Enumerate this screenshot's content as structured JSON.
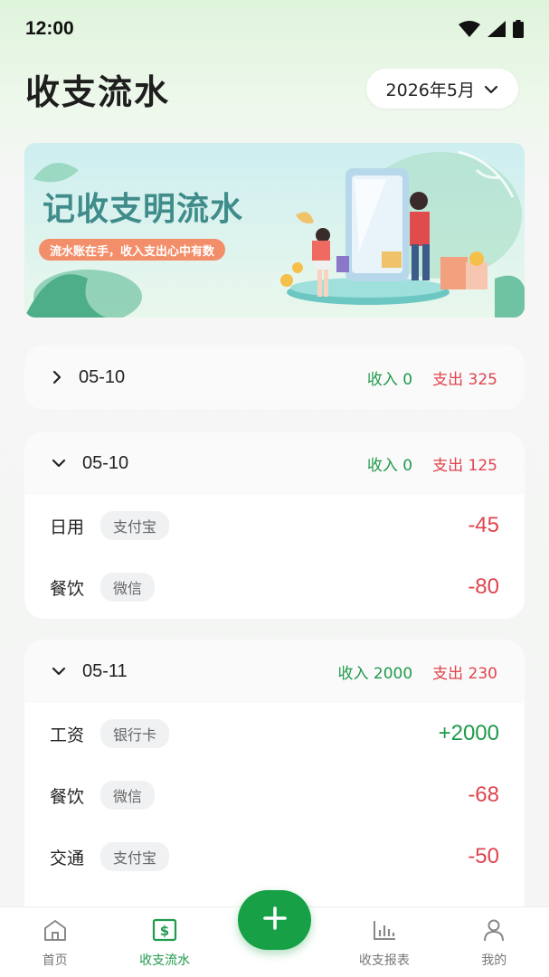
{
  "status_bar": {
    "time": "12:00"
  },
  "header": {
    "title": "收支流水",
    "month": "2026年5月"
  },
  "banner": {
    "title": "记收支明流水",
    "subtitle": "流水账在手，收入支出心中有数"
  },
  "groups": [
    {
      "date": "05-10",
      "expanded": false,
      "income": "收入 0",
      "expense": "支出 325",
      "items": []
    },
    {
      "date": "05-10",
      "expanded": true,
      "income": "收入 0",
      "expense": "支出 125",
      "items": [
        {
          "category": "日用",
          "method": "支付宝",
          "amount": "-45",
          "type": "expense"
        },
        {
          "category": "餐饮",
          "method": "微信",
          "amount": "-80",
          "type": "expense"
        }
      ]
    },
    {
      "date": "05-11",
      "expanded": true,
      "income": "收入 2000",
      "expense": "支出 230",
      "items": [
        {
          "category": "工资",
          "method": "银行卡",
          "amount": "+2000",
          "type": "income"
        },
        {
          "category": "餐饮",
          "method": "微信",
          "amount": "-68",
          "type": "expense"
        },
        {
          "category": "交通",
          "method": "支付宝",
          "amount": "-50",
          "type": "expense"
        }
      ]
    }
  ],
  "nav": {
    "home": "首页",
    "flow": "收支流水",
    "report": "收支报表",
    "mine": "我的"
  },
  "colors": {
    "accent": "#17a046",
    "income": "#1f9a4b",
    "expense": "#e0444e"
  },
  "icons": [
    "wifi-icon",
    "signal-icon",
    "battery-icon",
    "chevron-down-icon",
    "chevron-right-icon",
    "home-icon",
    "money-icon",
    "plus-icon",
    "bar-chart-icon",
    "user-icon"
  ]
}
